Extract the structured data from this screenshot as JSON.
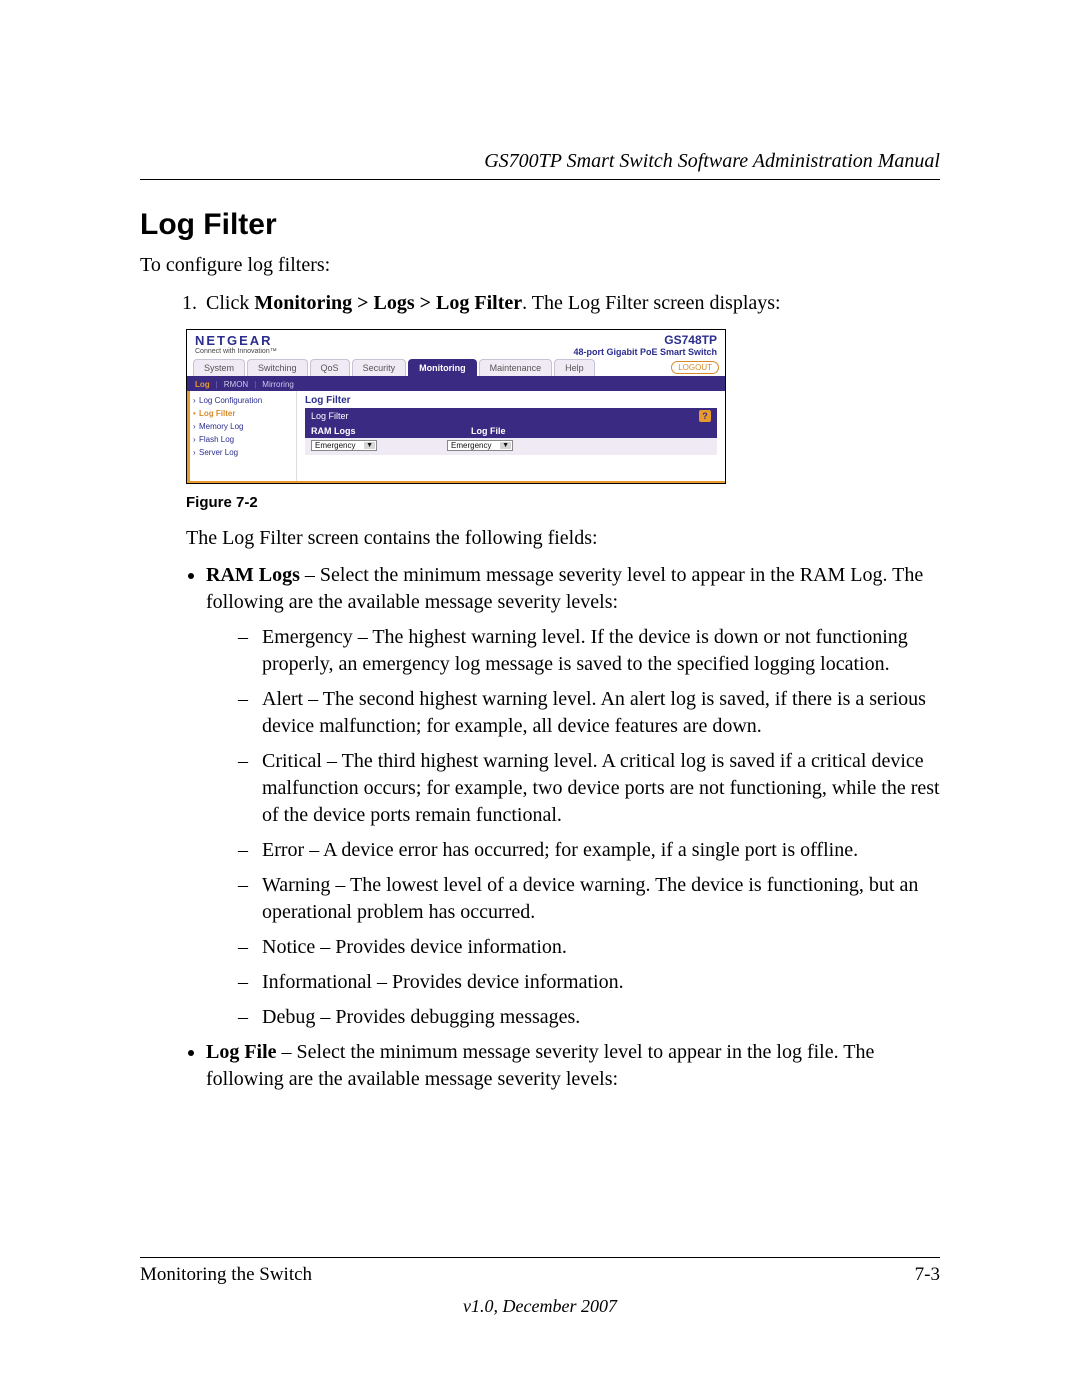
{
  "doc": {
    "running_head": "GS700TP Smart Switch Software Administration Manual",
    "section_title": "Log Filter",
    "intro": "To configure log filters:",
    "step1_prefix": "1.",
    "step1_a": "Click ",
    "step1_b_bold": "Monitoring > Logs > Log Filter",
    "step1_c": ". The Log Filter screen displays:",
    "figure_caption": "Figure 7-2",
    "after_figure": "The Log Filter screen contains the following fields:",
    "bullet1_bold": "RAM Logs",
    "bullet1_rest": " – Select the minimum message severity level to appear in the RAM Log. The following are the available message severity levels:",
    "sev": {
      "emergency": "Emergency – The highest warning level. If the device is down or not functioning properly, an emergency log message is saved to the specified logging location.",
      "alert": "Alert – The second highest warning level. An alert log is saved, if there is a serious device malfunction; for example, all device features are down.",
      "critical": "Critical – The third highest warning level. A critical log is saved if a critical device malfunction occurs; for example, two device ports are not functioning, while the rest of the device ports remain functional.",
      "error": "Error – A device error has occurred; for example, if a single port is offline.",
      "warning": "Warning – The lowest level of a device warning. The device is functioning, but an operational problem has occurred.",
      "notice": "Notice – Provides device information.",
      "informational": "Informational – Provides device information.",
      "debug": "Debug – Provides debugging messages."
    },
    "bullet2_bold": "Log File",
    "bullet2_rest": " – Select the minimum message severity level to appear in the log file. The following are the available message severity levels:",
    "footer_left": "Monitoring the Switch",
    "footer_right": "7-3",
    "footer_version": "v1.0, December 2007"
  },
  "ui": {
    "brand": "NETGEAR",
    "tagline": "Connect with Innovation™",
    "model": "GS748TP",
    "model_desc": "48-port Gigabit PoE Smart Switch",
    "logout": "LOGOUT",
    "tabs": [
      "System",
      "Switching",
      "QoS",
      "Security",
      "Monitoring",
      "Maintenance",
      "Help"
    ],
    "active_tab": "Monitoring",
    "subtabs": [
      "Log",
      "RMON",
      "Mirroring"
    ],
    "active_subtab": "Log",
    "side_items": [
      "Log Configuration",
      "Log Filter",
      "Memory Log",
      "Flash Log",
      "Server Log"
    ],
    "active_side": "Log Filter",
    "panel_title": "Log Filter",
    "panel_bar_label": "Log Filter",
    "help_q": "?",
    "field1": "RAM Logs",
    "field2": "Log File",
    "select_value": "Emergency"
  }
}
